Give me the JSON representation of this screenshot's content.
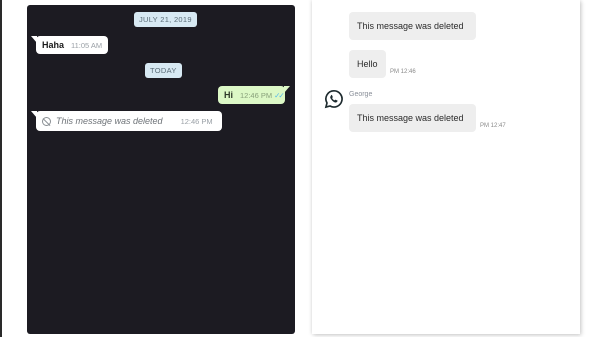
{
  "left_chat": {
    "date_chip": "JULY 21, 2019",
    "today_chip": "TODAY",
    "messages": [
      {
        "text": "Haha",
        "time": "11:05 AM",
        "direction": "incoming"
      },
      {
        "text": "Hi",
        "time": "12:46 PM",
        "direction": "outgoing",
        "ticks": "✓✓"
      },
      {
        "text": "This message was deleted",
        "time": "12:46 PM",
        "direction": "incoming",
        "icon": "ban-icon"
      }
    ],
    "colors": {
      "background": "#1c1b22",
      "incoming": "#ffffff",
      "outgoing": "#dcf8c6",
      "date_chip": "#d7e9f3"
    }
  },
  "right_chat": {
    "messages": [
      {
        "text": "This message was deleted",
        "time": ""
      },
      {
        "text": "Hello",
        "time": "PM 12:46"
      },
      {
        "text": "This message was deleted",
        "time": "PM 12:47"
      }
    ],
    "sender": "George",
    "icon": "whatsapp-icon",
    "colors": {
      "bubble": "#eeeeee",
      "icon": "#1d2a2e"
    }
  }
}
